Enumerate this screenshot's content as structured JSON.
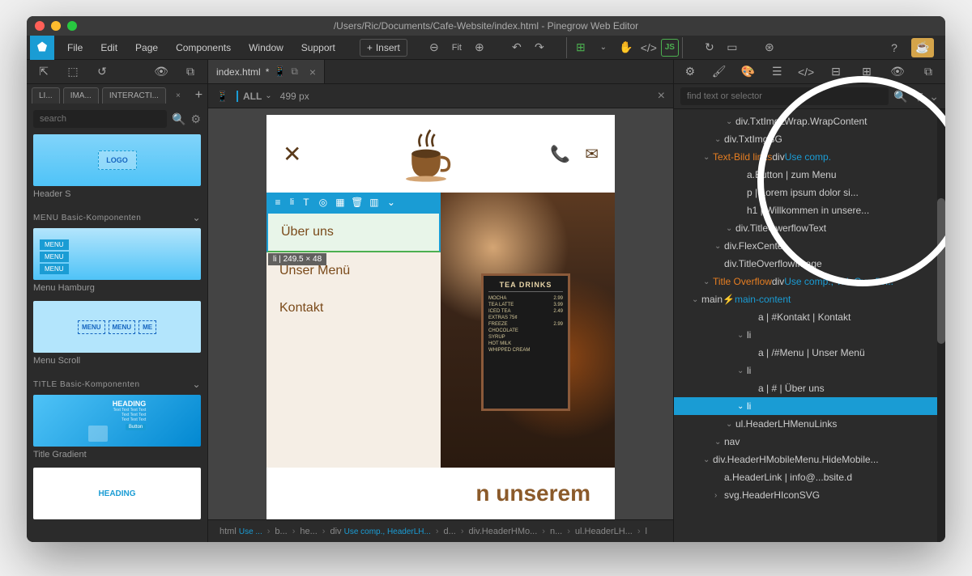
{
  "window": {
    "title": "/Users/Ric/Documents/Cafe-Website/index.html - Pinegrow Web Editor"
  },
  "menubar": {
    "items": [
      "File",
      "Edit",
      "Page",
      "Components",
      "Window",
      "Support"
    ],
    "insert_label": "Insert",
    "fit_label": "Fit",
    "js_label": "JS"
  },
  "left_panel": {
    "tabs": [
      "LI...",
      "IMA...",
      "INTERACTI..."
    ],
    "search_placeholder": "search",
    "components": [
      {
        "label": "Header S",
        "type": "header-s"
      },
      {
        "section": "MENU Basic-Komponenten"
      },
      {
        "label": "Menu Hamburg",
        "type": "menu-hamburg",
        "items": [
          "MENU",
          "MENU",
          "MENU"
        ]
      },
      {
        "label": "Menu Scroll",
        "type": "menu-scroll",
        "items": [
          "MENU",
          "MENU",
          "ME"
        ]
      },
      {
        "section": "TITLE Basic-Komponenten"
      },
      {
        "label": "Title Gradient",
        "type": "title-gradient",
        "heading": "HEADING",
        "button": "Button"
      },
      {
        "label": "",
        "type": "heading",
        "heading": "HEADING"
      }
    ],
    "logo_text": "LOGO"
  },
  "doc": {
    "tab_name": "index.html",
    "tab_dirty": "*",
    "viewport_label": "ALL",
    "viewport_width": "499 px"
  },
  "canvas": {
    "nav_items": [
      "Über uns",
      "Unser Menü",
      "Kontakt"
    ],
    "dim_label": "li | 249.5 × 48",
    "sel_toolbar_label": "li",
    "hero_text_fragment": "n unserem",
    "chalk": {
      "title": "TEA DRINKS",
      "lines": [
        [
          "MOCHA",
          "2.99"
        ],
        [
          "TEA LATTE",
          "3.99"
        ],
        [
          "ICED TEA",
          "2.49"
        ],
        [
          "EXTRAS 75¢",
          ""
        ],
        [
          "FREEZE",
          "2.99"
        ],
        [
          "CHOCOLATE",
          ""
        ],
        [
          "SYRUP",
          ""
        ],
        [
          "HOT MILK",
          ""
        ],
        [
          "WHIPPED CREAM",
          ""
        ]
      ]
    }
  },
  "breadcrumb": [
    {
      "text": "html",
      "link": "Use ..."
    },
    {
      "text": "b..."
    },
    {
      "text": "he..."
    },
    {
      "text": "div",
      "link": "Use comp., HeaderLH..."
    },
    {
      "text": "d..."
    },
    {
      "text": "div.HeaderHMo..."
    },
    {
      "text": "n..."
    },
    {
      "text": "ul.HeaderLH..."
    },
    {
      "text": "l"
    }
  ],
  "tree": {
    "search_placeholder": "find text or selector",
    "rows": [
      {
        "indent": 3,
        "chev": "›",
        "text": "svg.HeaderHIconSVG",
        "cutoff": true
      },
      {
        "indent": 3,
        "chev": "",
        "text": "a.HeaderLink | info@...bsite.d",
        "cutoff": true
      },
      {
        "indent": 2,
        "chev": "⌄",
        "text": "div.HeaderHMobileMenu.HideMobile...",
        "cutoff": true
      },
      {
        "indent": 3,
        "chev": "⌄",
        "text": "nav"
      },
      {
        "indent": 4,
        "chev": "⌄",
        "text": "ul.HeaderLHMenuLinks"
      },
      {
        "indent": 5,
        "chev": "⌄",
        "text": "li",
        "selected": true
      },
      {
        "indent": 6,
        "chev": "",
        "text": "a | # | Über uns"
      },
      {
        "indent": 5,
        "chev": "⌄",
        "text": "li"
      },
      {
        "indent": 6,
        "chev": "",
        "text": "a | /#Menu | Unser Menü"
      },
      {
        "indent": 5,
        "chev": "⌄",
        "text": "li"
      },
      {
        "indent": 6,
        "chev": "",
        "text": "a | #Kontakt | Kontakt"
      },
      {
        "indent": 1,
        "chev": "⌄",
        "text": "main",
        "link_blue": "main-content",
        "link_icon": true
      },
      {
        "indent": 2,
        "chev": "⌄",
        "orange": "Title Overflow",
        "text": " div ",
        "link_blue": "Use comp., TitleOverflo...",
        "cutoff": true
      },
      {
        "indent": 3,
        "chev": "",
        "text": "div.TitleOverflowImage"
      },
      {
        "indent": 3,
        "chev": "⌄",
        "text": "div.FlexCenter"
      },
      {
        "indent": 4,
        "chev": "⌄",
        "text": "div.TitleOwerflowText"
      },
      {
        "indent": 5,
        "chev": "",
        "text": "h1 | Willkommen in unsere..."
      },
      {
        "indent": 5,
        "chev": "",
        "text": "p | Lorem ipsum dolor si..."
      },
      {
        "indent": 5,
        "chev": "",
        "text": "a.Button | zum Menu"
      },
      {
        "indent": 2,
        "chev": "⌄",
        "orange": "Text-Bild links",
        "text": " div ",
        "link_blue": "Use comp."
      },
      {
        "indent": 3,
        "chev": "⌄",
        "text": "div.TxtImgBG"
      },
      {
        "indent": 4,
        "chev": "⌄",
        "text": "div.TxtImgLWrap.WrapContent"
      }
    ]
  }
}
